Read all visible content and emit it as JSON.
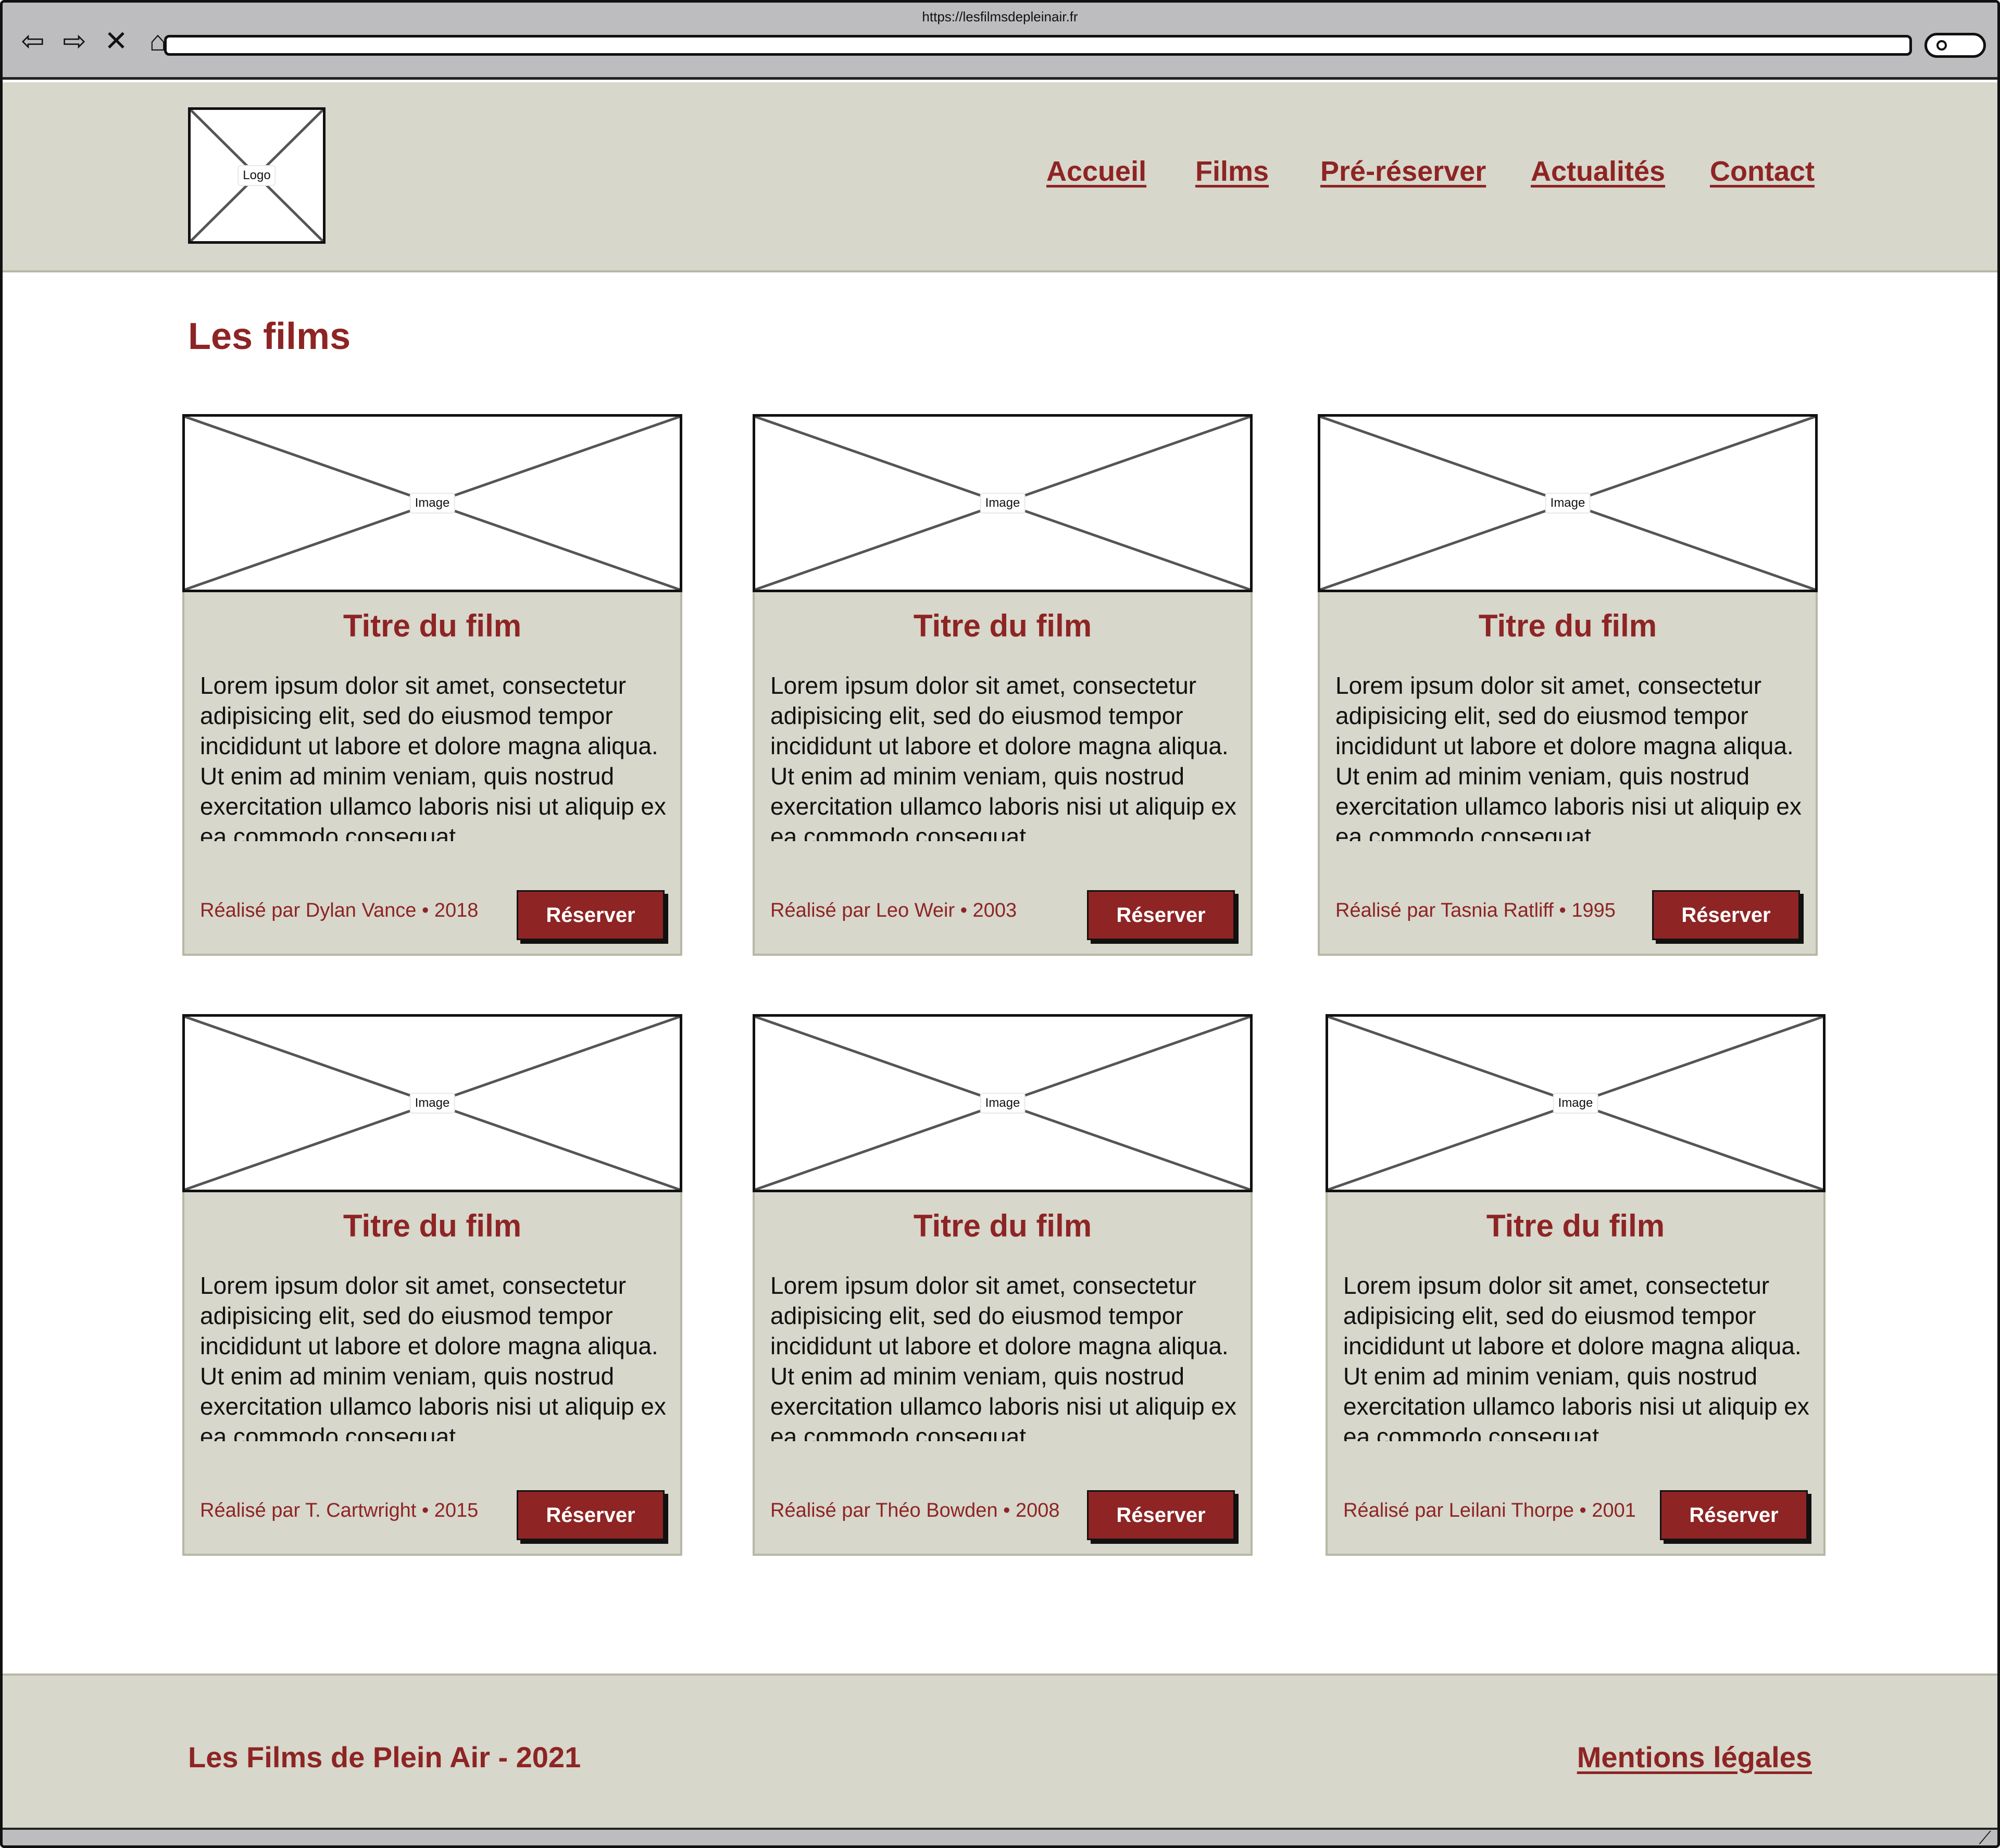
{
  "browser": {
    "url": "https://lesfilmsdepleinair.fr",
    "icons": [
      "back-arrow-icon",
      "forward-arrow-icon",
      "close-x-icon",
      "home-icon",
      "search-icon"
    ]
  },
  "header": {
    "logo_label": "Logo",
    "nav": [
      {
        "label": "Accueil"
      },
      {
        "label": "Films"
      },
      {
        "label": "Pré-réserver"
      },
      {
        "label": "Actualités"
      },
      {
        "label": "Contact"
      }
    ]
  },
  "main": {
    "title": "Les films",
    "cards": [
      {
        "image_label": "Image",
        "title": "Titre du film",
        "description": "Lorem ipsum dolor sit amet, consectetur adipisicing elit, sed do eiusmod tempor incididunt ut labore et dolore magna aliqua. Ut enim ad minim veniam, quis nostrud exercitation ullamco laboris nisi ut aliquip ex ea commodo consequat.",
        "credit": "Réalisé par Dylan Vance • 2018",
        "button": "Réserver"
      },
      {
        "image_label": "Image",
        "title": "Titre du film",
        "description": "Lorem ipsum dolor sit amet, consectetur adipisicing elit, sed do eiusmod tempor incididunt ut labore et dolore magna aliqua. Ut enim ad minim veniam, quis nostrud exercitation ullamco laboris nisi ut aliquip ex ea commodo consequat.",
        "credit": "Réalisé par Leo Weir • 2003",
        "button": "Réserver"
      },
      {
        "image_label": "Image",
        "title": "Titre du film",
        "description": "Lorem ipsum dolor sit amet, consectetur adipisicing elit, sed do eiusmod tempor incididunt ut labore et dolore magna aliqua. Ut enim ad minim veniam, quis nostrud exercitation ullamco laboris nisi ut aliquip ex ea commodo consequat.",
        "credit": "Réalisé par Tasnia Ratliff • 1995",
        "button": "Réserver"
      },
      {
        "image_label": "Image",
        "title": "Titre du film",
        "description": "Lorem ipsum dolor sit amet, consectetur adipisicing elit, sed do eiusmod tempor incididunt ut labore et dolore magna aliqua. Ut enim ad minim veniam, quis nostrud exercitation ullamco laboris nisi ut aliquip ex ea commodo consequat.",
        "credit": "Réalisé par T. Cartwright • 2015",
        "button": "Réserver"
      },
      {
        "image_label": "Image",
        "title": "Titre du film",
        "description": "Lorem ipsum dolor sit amet, consectetur adipisicing elit, sed do eiusmod tempor incididunt ut labore et dolore magna aliqua. Ut enim ad minim veniam, quis nostrud exercitation ullamco laboris nisi ut aliquip ex ea commodo consequat.",
        "credit": "Réalisé par Théo Bowden • 2008",
        "button": "Réserver"
      },
      {
        "image_label": "Image",
        "title": "Titre du film",
        "description": "Lorem ipsum dolor sit amet, consectetur adipisicing elit, sed do eiusmod tempor incididunt ut labore et dolore magna aliqua. Ut enim ad minim veniam, quis nostrud exercitation ullamco laboris nisi ut aliquip ex ea commodo consequat.",
        "credit": "Réalisé par Leilani Thorpe • 2001",
        "button": "Réserver"
      }
    ]
  },
  "footer": {
    "copyright": "Les Films de Plein Air - 2021",
    "legal_link": "Mentions légales"
  },
  "colors": {
    "accent": "#8e2424",
    "panel": "#d7d7cb",
    "panel_border": "#b7b8a5",
    "chrome": "#bdbdbf"
  }
}
